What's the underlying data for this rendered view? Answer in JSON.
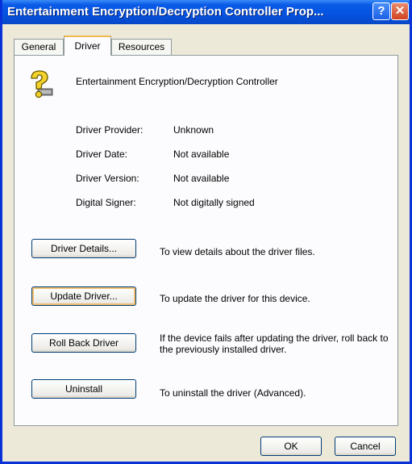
{
  "window": {
    "title": "Entertainment Encryption/Decryption Controller Prop...",
    "help_glyph": "?",
    "close_glyph": "✕"
  },
  "tabs": [
    {
      "label": "General",
      "selected": false
    },
    {
      "label": "Driver",
      "selected": true
    },
    {
      "label": "Resources",
      "selected": false
    }
  ],
  "device": {
    "icon": "unknown-device-question-icon",
    "name": "Entertainment Encryption/Decryption Controller"
  },
  "properties": [
    {
      "label": "Driver Provider:",
      "value": "Unknown"
    },
    {
      "label": "Driver Date:",
      "value": "Not available"
    },
    {
      "label": "Driver Version:",
      "value": "Not available"
    },
    {
      "label": "Digital Signer:",
      "value": "Not digitally signed"
    }
  ],
  "actions": [
    {
      "label": "Driver Details...",
      "description": "To view details about the driver files."
    },
    {
      "label": "Update Driver...",
      "description": "To update the driver for this device."
    },
    {
      "label": "Roll Back Driver",
      "description": "If the device fails after updating the driver, roll back to the previously installed driver."
    },
    {
      "label": "Uninstall",
      "description": "To uninstall the driver (Advanced)."
    }
  ],
  "footer": {
    "ok_label": "OK",
    "cancel_label": "Cancel"
  },
  "colors": {
    "titlebar": "#0553e0",
    "dialog_bg": "#ece9d8",
    "tab_highlight": "#f0b94d"
  }
}
